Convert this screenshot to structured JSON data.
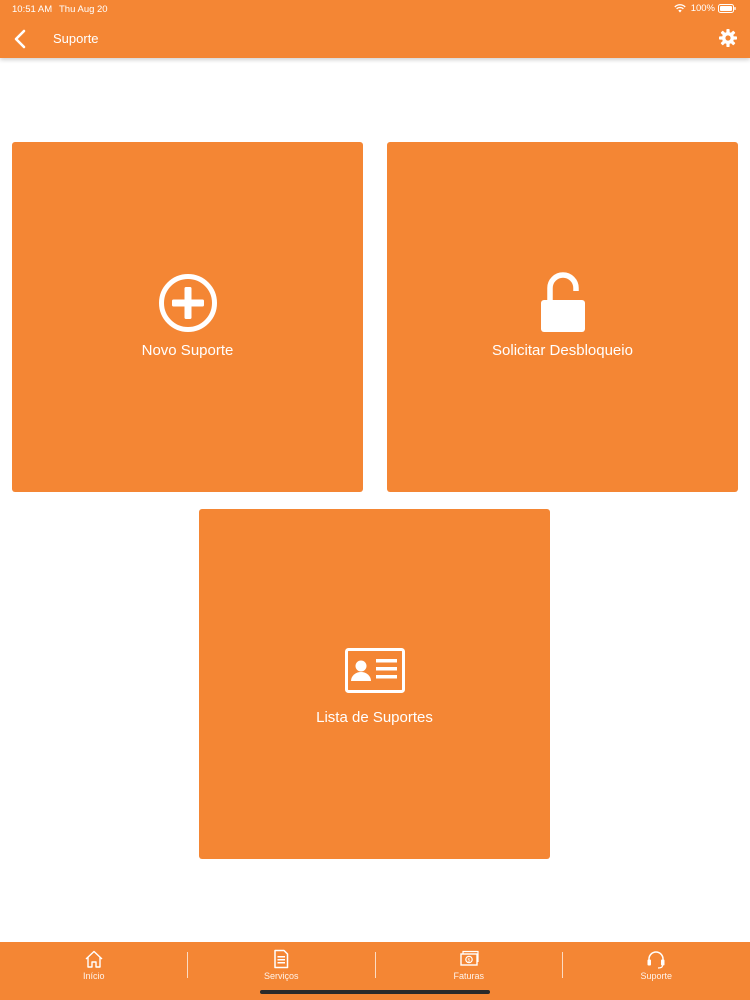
{
  "status_bar": {
    "time": "10:51 AM",
    "date": "Thu Aug 20",
    "battery": "100%"
  },
  "header": {
    "title": "Suporte"
  },
  "tiles": [
    {
      "label": "Novo Suporte",
      "icon": "plus-circle-icon"
    },
    {
      "label": "Solicitar Desbloqueio",
      "icon": "unlock-icon"
    },
    {
      "label": "Lista de Suportes",
      "icon": "id-card-icon"
    }
  ],
  "tab_bar": {
    "items": [
      {
        "label": "Início",
        "icon": "home-icon"
      },
      {
        "label": "Serviços",
        "icon": "document-icon"
      },
      {
        "label": "Faturas",
        "icon": "money-icon"
      },
      {
        "label": "Suporte",
        "icon": "headset-icon"
      }
    ]
  },
  "colors": {
    "accent": "#F48634",
    "background": "#FFFFFF",
    "text": "#FFFFFF"
  }
}
